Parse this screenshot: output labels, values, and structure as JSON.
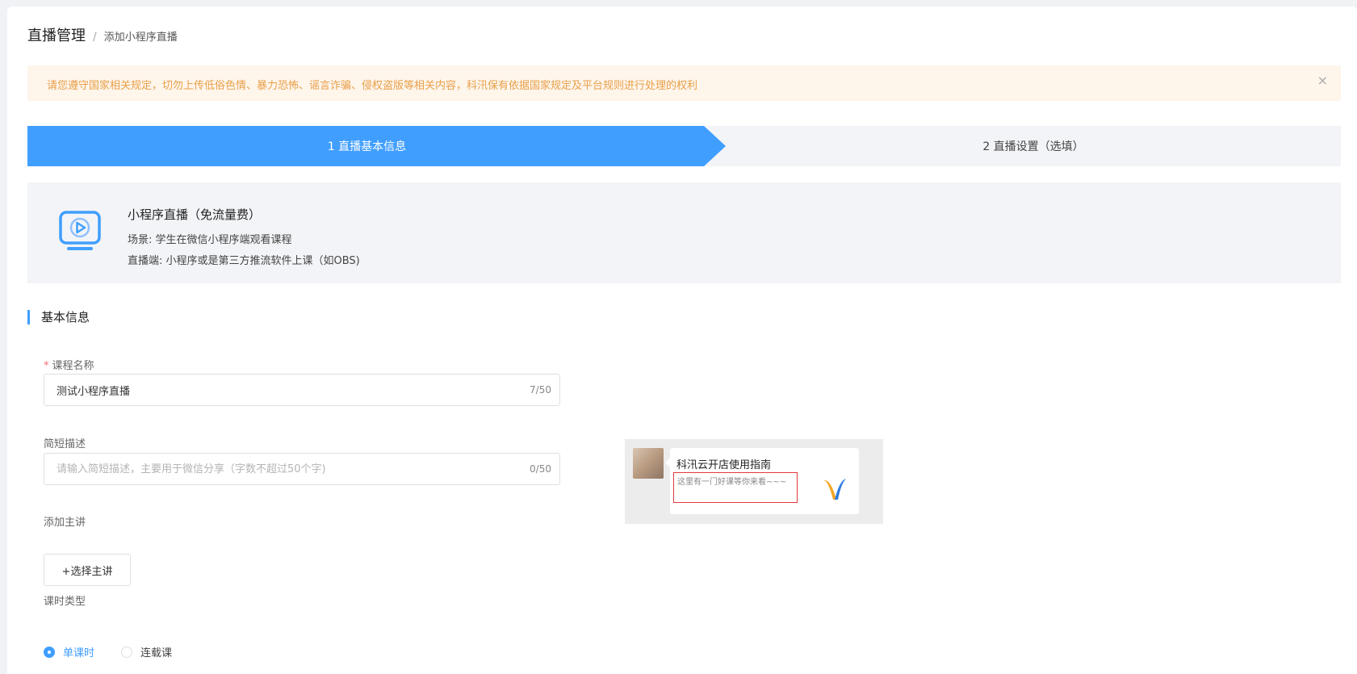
{
  "breadcrumb": {
    "main": "直播管理",
    "separator": "/",
    "current": "添加小程序直播"
  },
  "notice": {
    "text": "请您遵守国家相关规定，切勿上传低俗色情、暴力恐怖、谣言诈骗、侵权盗版等相关内容，科汛保有依据国家规定及平台规则进行处理的权利",
    "close_icon": "×"
  },
  "steps": [
    {
      "label": "1 直播基本信息",
      "active": true
    },
    {
      "label": "2 直播设置（选填）",
      "active": false
    }
  ],
  "intro": {
    "icon": "tv-play-icon",
    "title": "小程序直播（免流量费）",
    "scene": "场景: 学生在微信小程序端观看课程",
    "client": "直播端: 小程序或是第三方推流软件上课（如OBS)"
  },
  "section": {
    "title": "基本信息"
  },
  "form": {
    "course_name": {
      "required_mark": "*",
      "label": "课程名称",
      "value": "测试小程序直播",
      "counter": "7/50"
    },
    "short_desc": {
      "label": "简短描述",
      "placeholder": "请输入简短描述，主要用于微信分享（字数不超过50个字)",
      "counter": "0/50"
    },
    "lecturer": {
      "label": "添加主讲",
      "button": "+选择主讲"
    },
    "lesson_type": {
      "label": "课时类型",
      "options": [
        {
          "label": "单课时",
          "checked": true
        },
        {
          "label": "连载课",
          "checked": false
        }
      ]
    }
  },
  "preview": {
    "title": "科汛云开店使用指南",
    "desc": "这里有一门好课等你来看~~~"
  },
  "colors": {
    "primary": "#409eff",
    "warning_text": "#e8a04a",
    "warning_bg": "#fef5eb",
    "required": "#f56c6c",
    "highlight_box": "#e4393c"
  }
}
